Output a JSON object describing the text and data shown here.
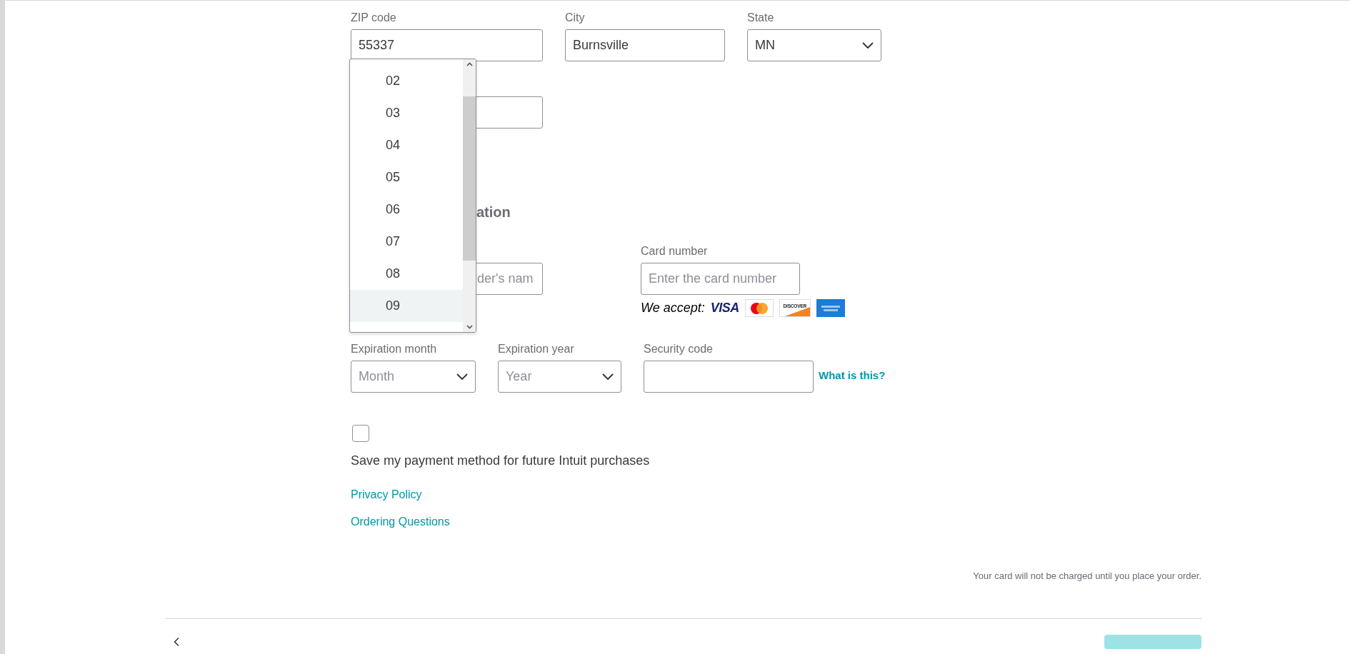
{
  "address": {
    "fields": [
      {
        "label": "ZIP code",
        "value": "55337",
        "kind": "text"
      },
      {
        "label": "City",
        "value": "Burnsville",
        "kind": "text"
      },
      {
        "label": "State",
        "value": "MN",
        "kind": "select"
      }
    ]
  },
  "month_dropdown": {
    "options": [
      {
        "label": "02",
        "selected": false
      },
      {
        "label": "03",
        "selected": false
      },
      {
        "label": "04",
        "selected": false
      },
      {
        "label": "05",
        "selected": false
      },
      {
        "label": "06",
        "selected": false
      },
      {
        "label": "07",
        "selected": false
      },
      {
        "label": "08",
        "selected": false
      },
      {
        "label": "09",
        "selected": true
      }
    ]
  },
  "section_heading": "ation",
  "card_holder": {
    "placeholder": "der's nam"
  },
  "card_number": {
    "label": "Card number",
    "placeholder": "Enter the card number"
  },
  "we_accept": "We accept:",
  "card_logos": [
    {
      "kind": "visa",
      "text": "VISA"
    },
    {
      "kind": "mastercard"
    },
    {
      "kind": "discover",
      "text": "DISCOVER"
    },
    {
      "kind": "amex"
    }
  ],
  "expiration": [
    {
      "label": "Expiration month",
      "placeholder": "Month",
      "kind": "select"
    },
    {
      "label": "Expiration year",
      "placeholder": "Year",
      "kind": "select"
    },
    {
      "label": "Security code",
      "kind": "text"
    }
  ],
  "help_link": "What is this?",
  "save_payment": {
    "checked": false,
    "label": "Save my payment method for future Intuit purchases"
  },
  "links": [
    "Privacy Policy",
    "Ordering Questions"
  ],
  "charge_note": "Your card will not be charged until you place your order."
}
